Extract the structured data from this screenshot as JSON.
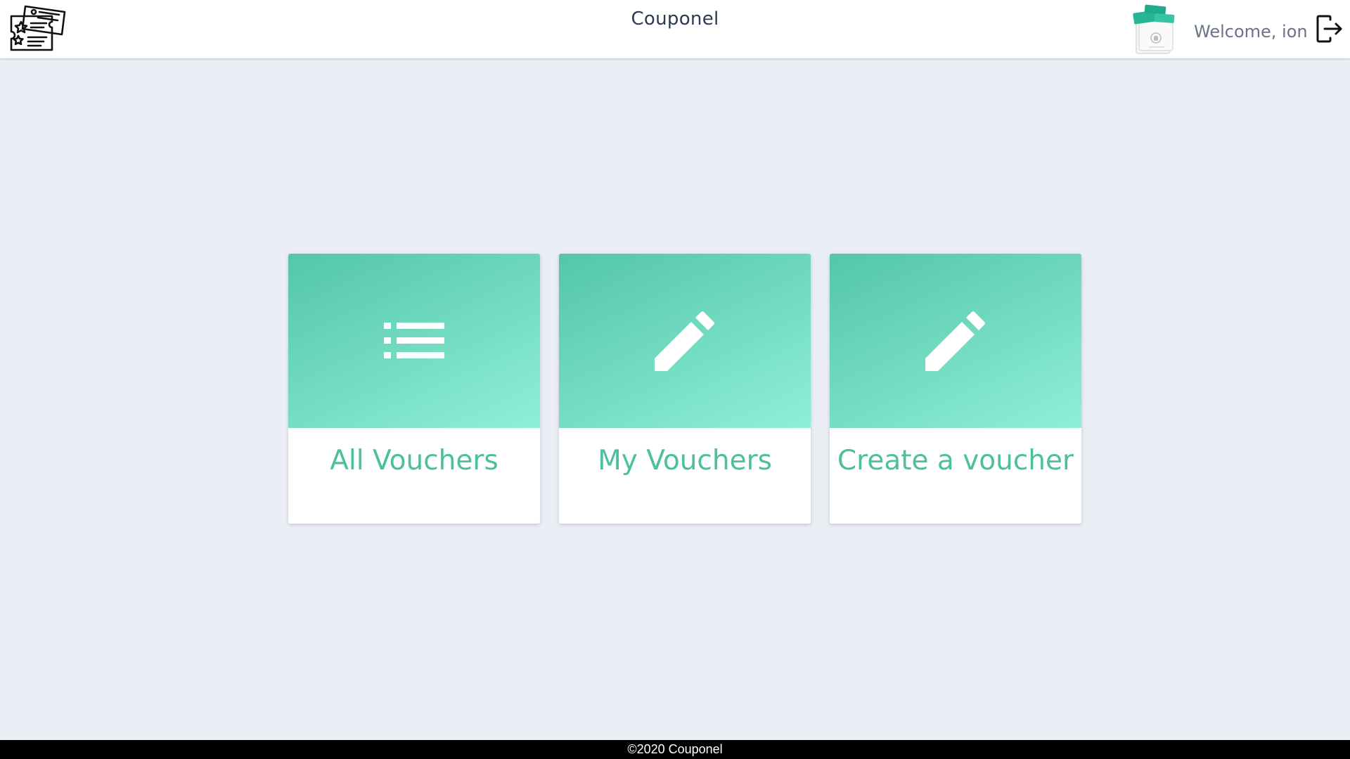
{
  "header": {
    "logo_icon": "coupon-tickets-icon",
    "title": "Couponel",
    "avatar_icon": "coupons-avatar-icon",
    "welcome_text": "Welcome, ion",
    "logout_icon": "logout-icon"
  },
  "cards": [
    {
      "icon": "list-icon",
      "label": "All Vouchers"
    },
    {
      "icon": "pencil-icon",
      "label": "My Vouchers"
    },
    {
      "icon": "pencil-icon",
      "label": "Create a voucher"
    }
  ],
  "footer": {
    "text": "©2020 Couponel"
  },
  "colors": {
    "accent": "#5fcfb2",
    "card_text": "#4cbf9f",
    "background": "#ebeef5",
    "title": "#2d3a55"
  }
}
